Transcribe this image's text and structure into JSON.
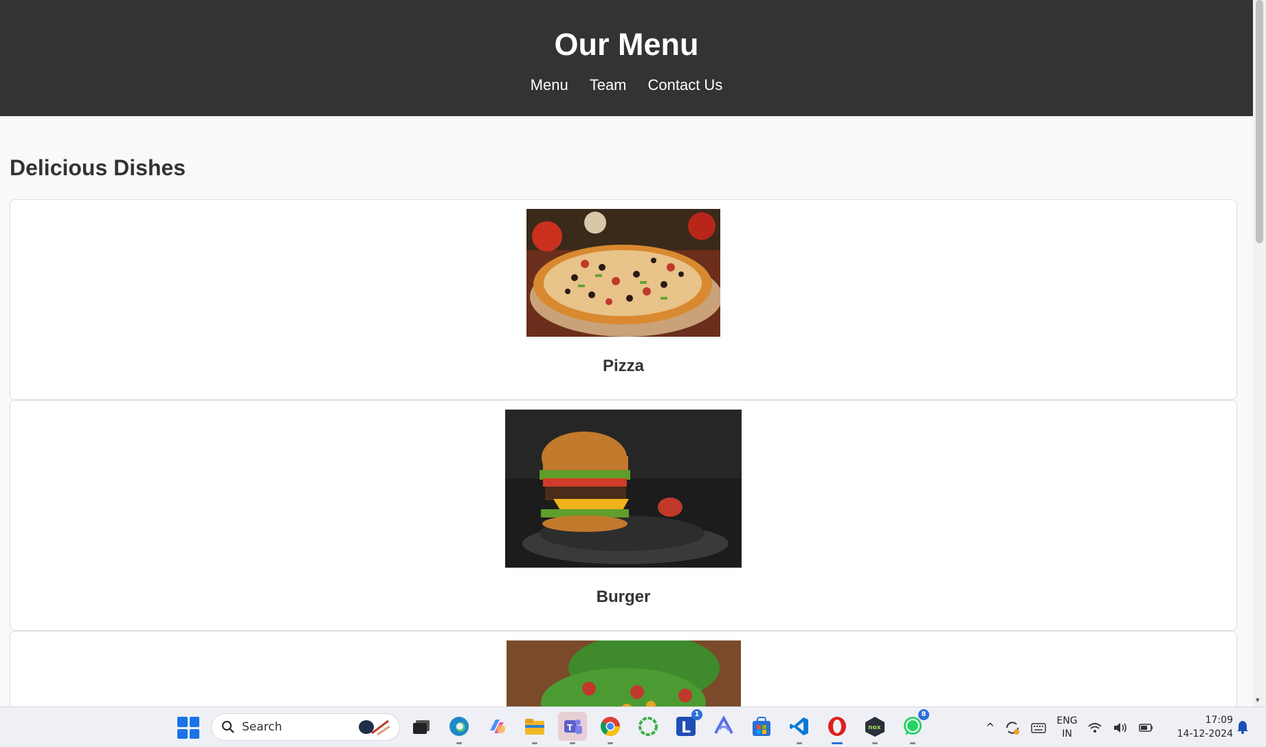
{
  "header": {
    "title": "Our Menu",
    "nav": [
      "Menu",
      "Team",
      "Contact Us"
    ]
  },
  "main": {
    "section_title": "Delicious Dishes",
    "dishes": [
      {
        "name": "Pizza",
        "image": "pizza-photo"
      },
      {
        "name": "Burger",
        "image": "burger-photo"
      },
      {
        "name": "",
        "image": "salad-photo"
      }
    ]
  },
  "taskbar": {
    "search_placeholder": "Search",
    "apps": [
      {
        "name": "task-view-icon"
      },
      {
        "name": "edge-icon"
      },
      {
        "name": "copilot-icon"
      },
      {
        "name": "file-explorer-icon"
      },
      {
        "name": "teams-icon"
      },
      {
        "name": "chrome-icon"
      },
      {
        "name": "circle-app-icon"
      },
      {
        "name": "l-app-icon",
        "badge": "1"
      },
      {
        "name": "arc-icon"
      },
      {
        "name": "store-icon"
      },
      {
        "name": "vscode-icon"
      },
      {
        "name": "opera-icon"
      },
      {
        "name": "nox-icon"
      },
      {
        "name": "whatsapp-icon",
        "badge": "8"
      }
    ],
    "language_line1": "ENG",
    "language_line2": "IN",
    "time": "17:09",
    "date": "14-12-2024"
  }
}
